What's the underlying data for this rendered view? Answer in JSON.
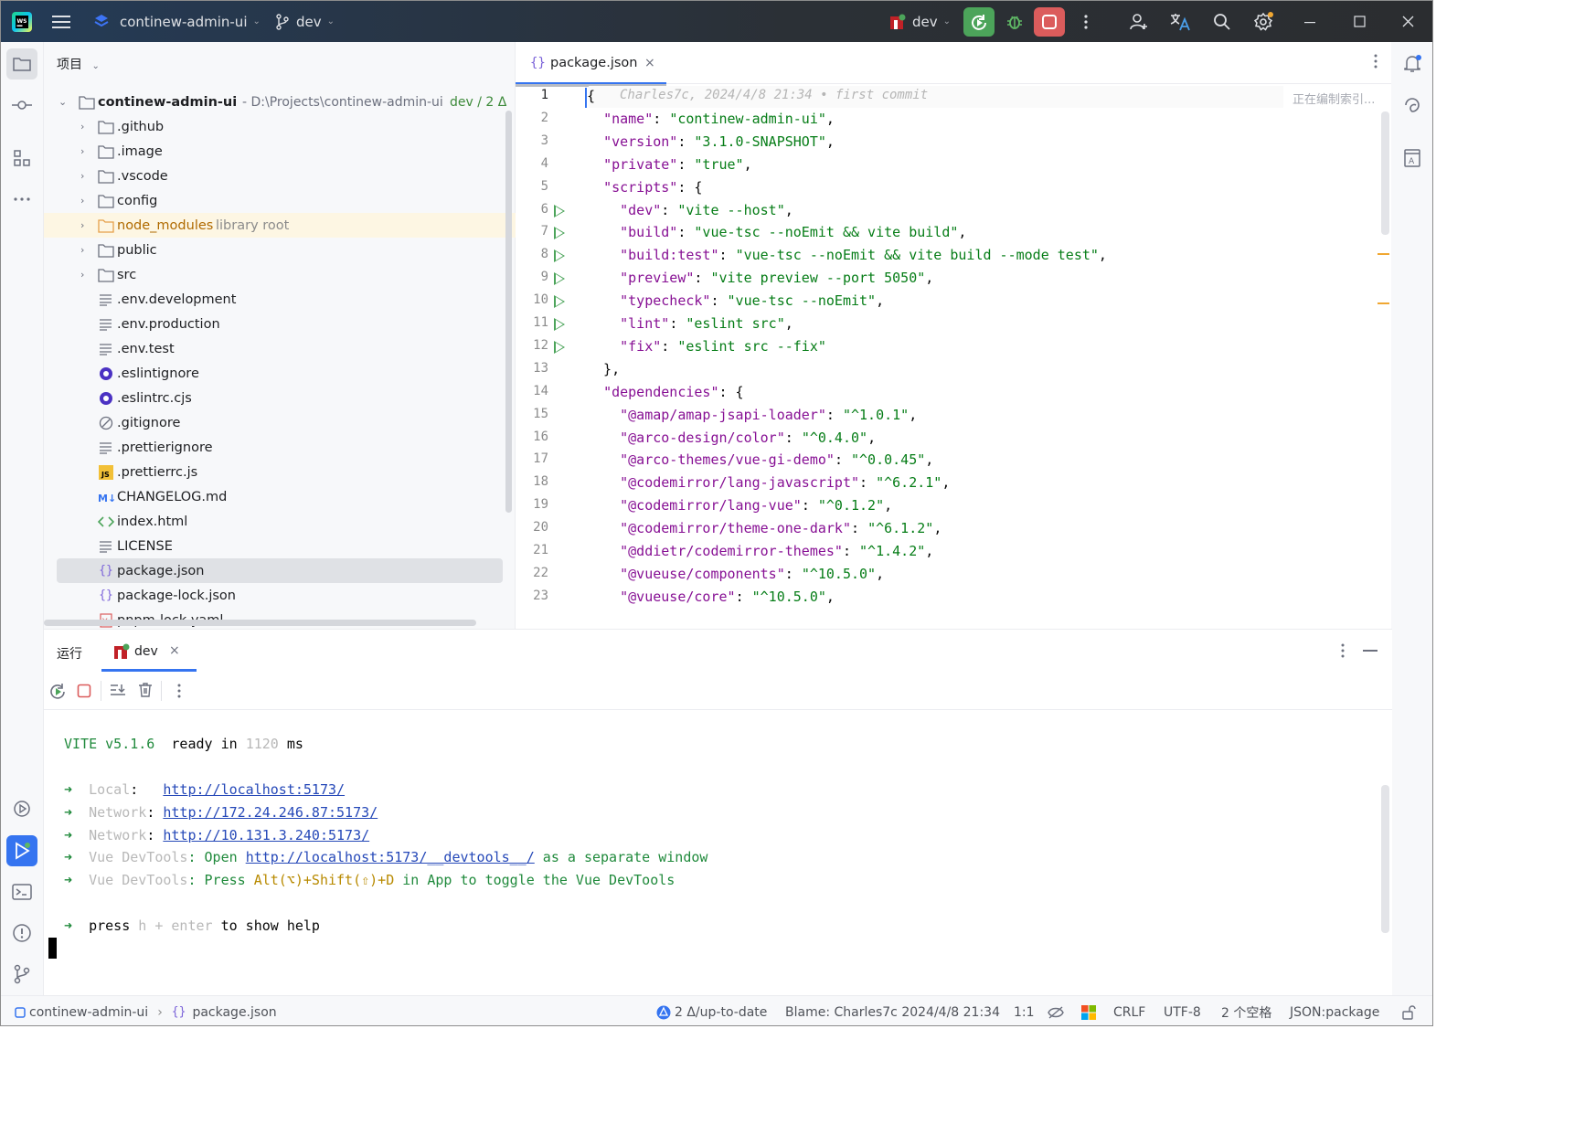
{
  "titlebar": {
    "project_name": "continew-admin-ui",
    "branch": "dev",
    "run_config": "dev",
    "colors": {
      "run_active": "#4ca45a",
      "stop": "#db5c5c"
    }
  },
  "project_panel": {
    "title": "项目",
    "root": {
      "name": "continew-admin-ui",
      "path": "- D:\\Projects\\continew-admin-ui",
      "vcs": "dev / 2 Δ"
    },
    "items": [
      {
        "name": ".github",
        "type": "folder"
      },
      {
        "name": ".image",
        "type": "folder"
      },
      {
        "name": ".vscode",
        "type": "folder"
      },
      {
        "name": "config",
        "type": "folder"
      },
      {
        "name": "node_modules",
        "type": "folder-excluded",
        "extra": "library root"
      },
      {
        "name": "public",
        "type": "folder"
      },
      {
        "name": "src",
        "type": "folder"
      },
      {
        "name": ".env.development",
        "type": "text"
      },
      {
        "name": ".env.production",
        "type": "text"
      },
      {
        "name": ".env.test",
        "type": "text"
      },
      {
        "name": ".eslintignore",
        "type": "eslint"
      },
      {
        "name": ".eslintrc.cjs",
        "type": "eslint"
      },
      {
        "name": ".gitignore",
        "type": "ignore"
      },
      {
        "name": ".prettierignore",
        "type": "text"
      },
      {
        "name": ".prettierrc.js",
        "type": "js"
      },
      {
        "name": "CHANGELOG.md",
        "type": "md"
      },
      {
        "name": "index.html",
        "type": "html"
      },
      {
        "name": "LICENSE",
        "type": "text"
      },
      {
        "name": "package.json",
        "type": "json"
      },
      {
        "name": "package-lock.json",
        "type": "json"
      },
      {
        "name": "pnpm-lock.yaml",
        "type": "yaml"
      }
    ]
  },
  "editor": {
    "tab_label": "package.json",
    "blame_inline": "Charles7c, 2024/4/8 21:34 • first commit",
    "indexing": "正在编制索引...",
    "lines": [
      "{",
      "  \"name\": \"continew-admin-ui\",",
      "  \"version\": \"3.1.0-SNAPSHOT\",",
      "  \"private\": \"true\",",
      "  \"scripts\": {",
      "    \"dev\": \"vite --host\",",
      "    \"build\": \"vue-tsc --noEmit && vite build\",",
      "    \"build:test\": \"vue-tsc --noEmit && vite build --mode test\",",
      "    \"preview\": \"vite preview --port 5050\",",
      "    \"typecheck\": \"vue-tsc --noEmit\",",
      "    \"lint\": \"eslint src\",",
      "    \"fix\": \"eslint src --fix\"",
      "  },",
      "  \"dependencies\": {",
      "    \"@amap/amap-jsapi-loader\": \"^1.0.1\",",
      "    \"@arco-design/color\": \"^0.4.0\",",
      "    \"@arco-themes/vue-gi-demo\": \"^0.0.45\",",
      "    \"@codemirror/lang-javascript\": \"^6.2.1\",",
      "    \"@codemirror/lang-vue\": \"^0.1.2\",",
      "    \"@codemirror/theme-one-dark\": \"^6.1.2\",",
      "    \"@ddietr/codemirror-themes\": \"^1.4.2\",",
      "    \"@vueuse/components\": \"^10.5.0\",",
      "    \"@vueuse/core\": \"^10.5.0\","
    ],
    "line_numbers": [
      "1",
      "2",
      "3",
      "4",
      "5",
      "6",
      "7",
      "8",
      "9",
      "10",
      "11",
      "12",
      "13",
      "14",
      "15",
      "16",
      "17",
      "18",
      "19",
      "20",
      "21",
      "22",
      "23"
    ]
  },
  "run_panel": {
    "title": "运行",
    "tab_label": "dev",
    "output": {
      "vite_name": "VITE v5.1.6",
      "ready": "ready in",
      "ms_value": "1120",
      "ms": "ms",
      "arrow": "➜",
      "local_label": "Local",
      "local_url": "http://localhost:5173/",
      "network_label": "Network",
      "network_url1": "http://172.24.246.87:5173/",
      "network_url2": "http://10.131.3.240:5173/",
      "devtools_label": "Vue DevTools",
      "open": "Open",
      "devtools_url": "http://localhost:5173/__devtools__/",
      "separate": "as a separate window",
      "press": "Press",
      "shortcut": "Alt(⌥)+Shift(⇧)+D",
      "toggle": "in App to toggle the Vue DevTools",
      "press_lower": "press",
      "help_keys": "h + enter",
      "show_help": "to show help"
    }
  },
  "statusbar": {
    "crumb_project": "continew-admin-ui",
    "crumb_file": "package.json",
    "vcs": "2 Δ/up-to-date",
    "blame": "Blame: Charles7c 2024/4/8 21:34",
    "position": "1:1",
    "line_sep": "CRLF",
    "encoding": "UTF-8",
    "indent": "2 个空格",
    "schema": "JSON:package"
  }
}
